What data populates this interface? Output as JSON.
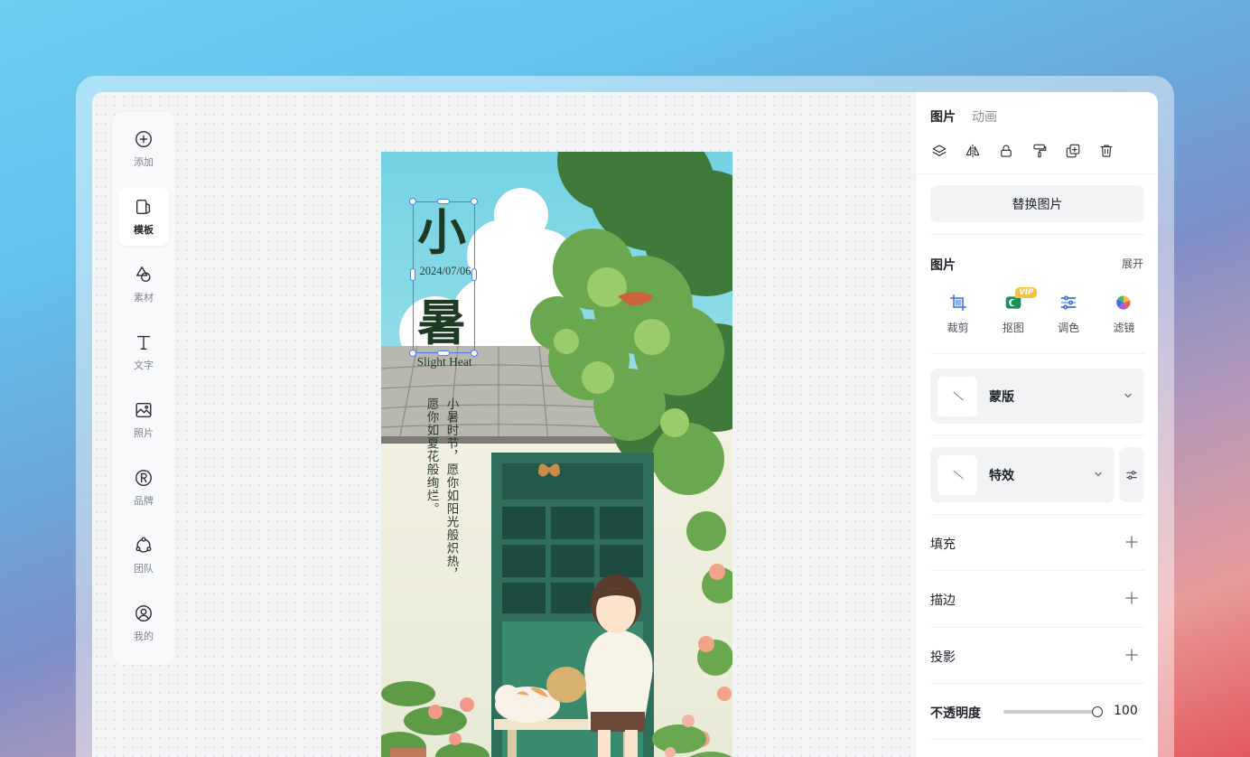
{
  "toolbar": {
    "items": [
      {
        "label": "添加",
        "icon": "plus-circle-icon"
      },
      {
        "label": "模板",
        "icon": "template-icon"
      },
      {
        "label": "素材",
        "icon": "shapes-icon"
      },
      {
        "label": "文字",
        "icon": "text-icon"
      },
      {
        "label": "照片",
        "icon": "image-icon"
      },
      {
        "label": "品牌",
        "icon": "registered-icon"
      },
      {
        "label": "团队",
        "icon": "team-icon"
      },
      {
        "label": "我的",
        "icon": "user-icon"
      }
    ],
    "active_index": 1
  },
  "poster": {
    "title_char1": "小",
    "title_char2": "暑",
    "date": "2024/07/06",
    "subtitle_en": "Slight Heat",
    "verse_right": "小暑时节，愿你如阳光般炽热，",
    "verse_left": "愿你如夏花般绚烂。"
  },
  "panel": {
    "tabs": [
      "图片",
      "动画"
    ],
    "active_tab": 0,
    "quick_icons": [
      "layers-icon",
      "flip-icon",
      "lock-icon",
      "format-painter-icon",
      "duplicate-icon",
      "trash-icon"
    ],
    "replace_label": "替换图片",
    "image_section": {
      "title": "图片",
      "expand_label": "展开",
      "tools": [
        {
          "label": "裁剪",
          "icon": "crop-icon"
        },
        {
          "label": "抠图",
          "icon": "cutout-icon",
          "badge": "VIP"
        },
        {
          "label": "调色",
          "icon": "color-adjust-icon"
        },
        {
          "label": "滤镜",
          "icon": "filter-icon"
        }
      ]
    },
    "mask_label": "蒙版",
    "effect_label": "特效",
    "rows": [
      "填充",
      "描边",
      "投影"
    ],
    "opacity": {
      "label": "不透明度",
      "value": "100",
      "fraction": 1.0
    }
  },
  "colors": {
    "accent_selection": "#4f7df5",
    "vip_badge": "#f5c143",
    "poster_title": "#1f3a22"
  }
}
